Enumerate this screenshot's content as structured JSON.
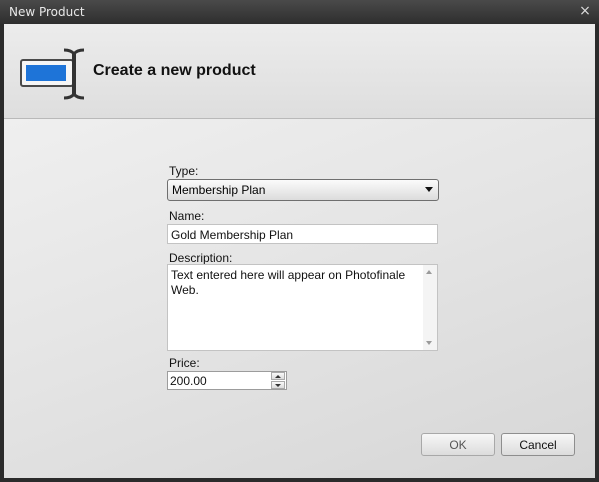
{
  "window": {
    "title": "New Product",
    "close_glyph": "×"
  },
  "header": {
    "title": "Create a new product",
    "icon": "text-field-icon",
    "icon_accent": "#1e74d8"
  },
  "form": {
    "type_label": "Type:",
    "type_value": "Membership Plan",
    "name_label": "Name:",
    "name_value": "Gold Membership Plan",
    "description_label": "Description:",
    "description_value": "Text entered here will appear on Photofinale Web.",
    "price_label": "Price:",
    "price_value": "200.00"
  },
  "buttons": {
    "ok_label": "OK",
    "cancel_label": "Cancel"
  }
}
